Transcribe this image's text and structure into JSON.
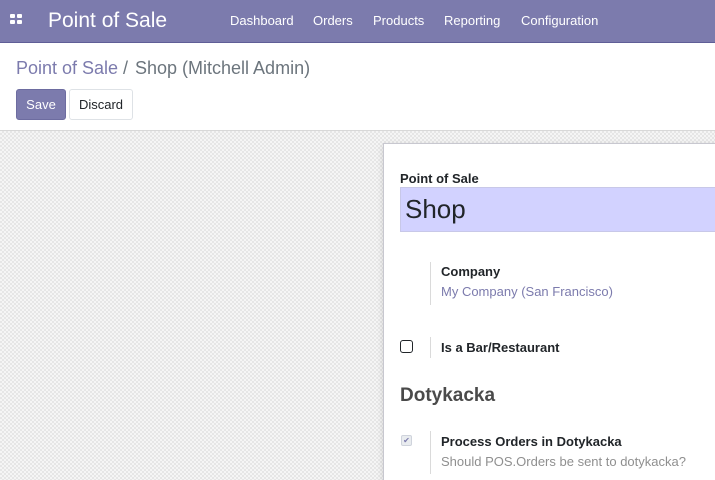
{
  "app": {
    "title": "Point of Sale",
    "menu": [
      "Dashboard",
      "Orders",
      "Products",
      "Reporting",
      "Configuration"
    ],
    "apps_icon": "grid-icon"
  },
  "breadcrumb": {
    "parent": "Point of Sale",
    "separator": "/",
    "current": "Shop (Mitchell Admin)"
  },
  "toolbar": {
    "save_label": "Save",
    "discard_label": "Discard"
  },
  "form": {
    "name_label": "Point of Sale",
    "name_value": "Shop",
    "company_label": "Company",
    "company_value": "My Company (San Francisco)",
    "bar_label": "Is a Bar/Restaurant",
    "bar_checked": false,
    "section_title": "Dotykacka",
    "dotykacka_label": "Process Orders in Dotykacka",
    "dotykacka_help": "Should POS.Orders be sent to dotykacka?",
    "dotykacka_checked": true,
    "check_glyph": "✔"
  },
  "colors": {
    "brand": "#7c7bad",
    "input_highlight": "#d2d2ff"
  }
}
